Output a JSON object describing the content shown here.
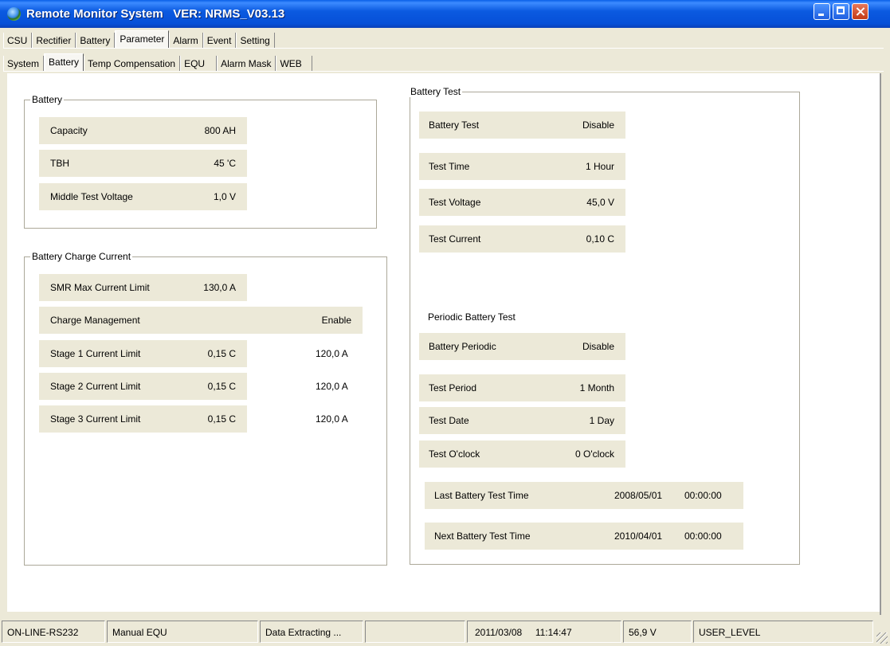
{
  "window": {
    "title": "Remote Monitor System   VER: NRMS_V03.13"
  },
  "tabs_main": [
    {
      "label": "CSU"
    },
    {
      "label": "Rectifier"
    },
    {
      "label": "Battery"
    },
    {
      "label": "Parameter",
      "active": true
    },
    {
      "label": "Alarm"
    },
    {
      "label": "Event"
    },
    {
      "label": "Setting"
    }
  ],
  "tabs_sub": [
    {
      "label": "System"
    },
    {
      "label": "Battery",
      "active": true
    },
    {
      "label": "Temp Compensation"
    },
    {
      "label": "EQU"
    },
    {
      "label": "Alarm Mask"
    },
    {
      "label": "WEB"
    }
  ],
  "battery_group": {
    "title": "Battery",
    "rows": [
      {
        "label": "Capacity",
        "value": "800 AH"
      },
      {
        "label": "TBH",
        "value": "45 'C"
      },
      {
        "label": "Middle Test Voltage",
        "value": "1,0 V"
      }
    ]
  },
  "charge_group": {
    "title": "Battery Charge Current",
    "smr": {
      "label": "SMR Max Current Limit",
      "value": "130,0 A"
    },
    "charge_mgmt": {
      "label": "Charge Management",
      "value": "Enable"
    },
    "stages": [
      {
        "label": "Stage 1 Current Limit",
        "value": "0,15 C",
        "amps": "120,0 A"
      },
      {
        "label": "Stage 2 Current Limit",
        "value": "0,15 C",
        "amps": "120,0 A"
      },
      {
        "label": "Stage 3 Current Limit",
        "value": "0,15 C",
        "amps": "120,0 A"
      }
    ]
  },
  "test_group": {
    "title": "Battery Test",
    "rows": [
      {
        "label": "Battery Test",
        "value": "Disable"
      },
      {
        "label": "Test Time",
        "value": "1 Hour"
      },
      {
        "label": "Test Voltage",
        "value": "45,0 V"
      },
      {
        "label": "Test Current",
        "value": "0,10 C"
      }
    ],
    "periodic_title": "Periodic Battery Test",
    "periodic_rows": [
      {
        "label": "Battery Periodic",
        "value": "Disable"
      },
      {
        "label": "Test Period",
        "value": "1 Month"
      },
      {
        "label": "Test Date",
        "value": "1 Day"
      },
      {
        "label": "Test O'clock",
        "value": "0 O'clock"
      }
    ],
    "last": {
      "label": "Last Battery Test Time",
      "date": "2008/05/01",
      "time": "00:00:00"
    },
    "next": {
      "label": "Next Battery Test Time",
      "date": "2010/04/01",
      "time": "00:00:00"
    }
  },
  "status": {
    "connection": "ON-LINE-RS232",
    "mode": "Manual EQU",
    "activity": "Data Extracting ...",
    "empty": "",
    "datetime": "2011/03/08     11:14:47",
    "voltage": "56,9 V",
    "level": "USER_LEVEL"
  }
}
